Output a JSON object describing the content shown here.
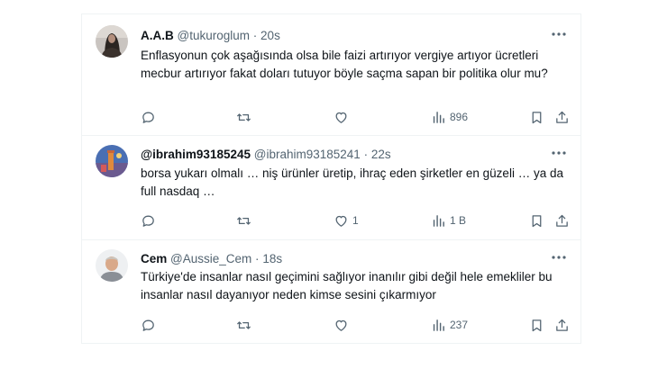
{
  "tweets": [
    {
      "name": "A.A.B",
      "handle": "@tukuroglum",
      "dot": "·",
      "time": "20s",
      "text": "Enflasyonun çok aşağısında olsa bile faizi artırıyor vergiye artıyor ücretleri mecbur artırıyor fakat doları tutuyor böyle saçma sapan bir politika olur mu?",
      "replies": "",
      "retweets": "",
      "likes": "",
      "views": "896"
    },
    {
      "name": "@ibrahim93185245",
      "handle": "@ibrahim93185241",
      "dot": "·",
      "time": "22s",
      "text": "borsa yukarı olmalı … niş ürünler üretip, ihraç eden şirketler en güzeli … ya da full nasdaq …",
      "replies": "",
      "retweets": "",
      "likes": "1",
      "views": "1 B"
    },
    {
      "name": "Cem",
      "handle": "@Aussie_Cem",
      "dot": "·",
      "time": "18s",
      "text": "Türkiye'de insanlar nasıl geçimini sağlıyor inanılır gibi değil hele emekliler bu insanlar nasıl dayanıyor neden kimse sesini çıkarmıyor",
      "replies": "",
      "retweets": "",
      "likes": "",
      "views": "237"
    }
  ],
  "icons": {
    "reply": "reply-icon",
    "retweet": "retweet-icon",
    "like": "heart-icon",
    "views": "views-icon",
    "bookmark": "bookmark-icon",
    "share": "share-icon",
    "more": "more-icon"
  },
  "colors": {
    "text": "#0f1419",
    "secondary": "#536471",
    "border": "#eff3f4"
  }
}
